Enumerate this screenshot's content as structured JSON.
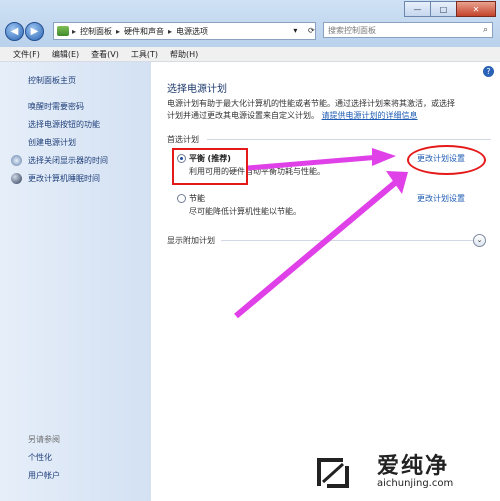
{
  "window": {
    "minimize_glyph": "—",
    "maximize_glyph": "□",
    "close_glyph": "✕"
  },
  "nav": {
    "back_glyph": "◀",
    "forward_glyph": "▶",
    "breadcrumb": [
      "控制面板",
      "硬件和声音",
      "电源选项"
    ],
    "separator": "▸",
    "dropdown_glyph": "▾",
    "refresh_glyph": "⟳",
    "search_placeholder": "搜索控制面板",
    "search_icon": "search-icon"
  },
  "menu": [
    "文件(F)",
    "编辑(E)",
    "查看(V)",
    "工具(T)",
    "帮助(H)"
  ],
  "sidebar": {
    "home": "控制面板主页",
    "items": [
      "唤醒时需要密码",
      "选择电源按钮的功能",
      "创建电源计划",
      "选择关闭显示器的时间",
      "更改计算机睡眠时间"
    ],
    "see_also_title": "另请参阅",
    "see_also": [
      "个性化",
      "用户帐户"
    ]
  },
  "main": {
    "help_glyph": "?",
    "title": "选择电源计划",
    "description_line1": "电源计划有助于最大化计算机的性能或者节能。通过选择计划来将其激活，或选择",
    "description_line2": "计划并通过更改其电源设置来自定义计划。",
    "description_link": "请提供电源计划的详细信息",
    "preferred_label": "首选计划",
    "plans": [
      {
        "name": "平衡",
        "tag": "(推荐)",
        "desc": "利用可用的硬件自动平衡功耗与性能。",
        "link": "更改计划设置",
        "selected": true
      },
      {
        "name": "节能",
        "tag": "",
        "desc": "尽可能降低计算机性能以节能。",
        "link": "更改计划设置",
        "selected": false
      }
    ],
    "show_more": "显示附加计划",
    "expander_glyph": "⌄"
  },
  "watermark": {
    "text": "爱纯净",
    "url": "aichunjing.com"
  },
  "colors": {
    "annotation_red": "#e41919",
    "annotation_arrow": "#e040e8",
    "link_blue": "#1e5cb3"
  }
}
